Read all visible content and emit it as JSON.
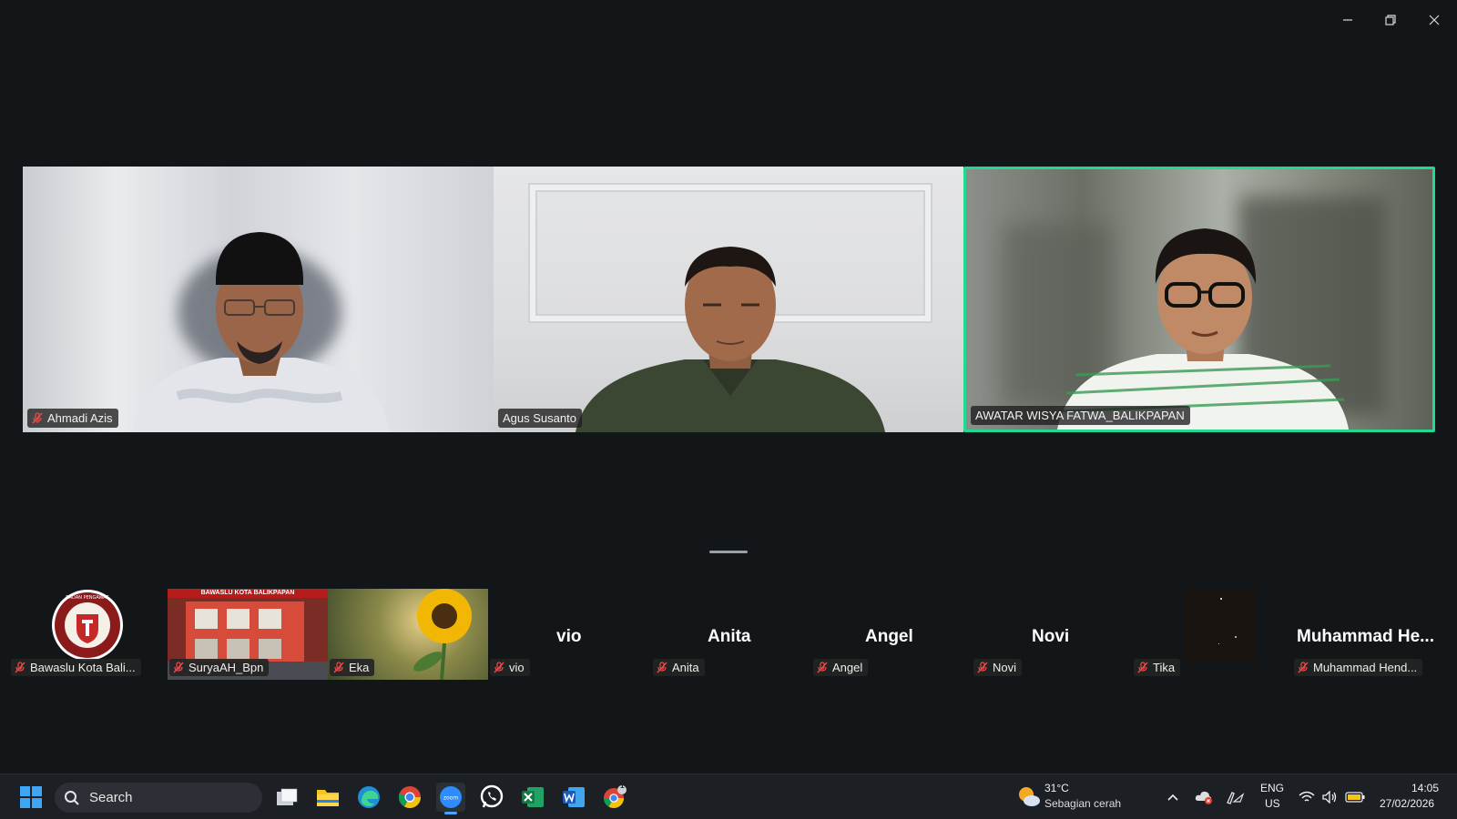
{
  "window": {
    "minimize_icon": "minimize-icon",
    "restore_icon": "restore-icon",
    "close_icon": "close-icon"
  },
  "gallery": {
    "participants": [
      {
        "name": "Ahmadi Azis",
        "muted": true
      },
      {
        "name": "Agus Susanto",
        "muted": false
      },
      {
        "name": "AWATAR WISYA FATWA_BALIKPAPAN",
        "muted": false,
        "active_speaker": true
      }
    ],
    "active_border_color": "#23d990"
  },
  "strip": {
    "participants": [
      {
        "tag": "Bawaslu Kota Bali...",
        "display": "",
        "type": "logo"
      },
      {
        "tag": "SuryaAH_Bpn",
        "display": "",
        "type": "video"
      },
      {
        "tag": "Eka",
        "display": "",
        "type": "video"
      },
      {
        "tag": "vio",
        "display": "vio",
        "type": "name"
      },
      {
        "tag": "Anita",
        "display": "Anita",
        "type": "name"
      },
      {
        "tag": "Angel",
        "display": "Angel",
        "type": "name"
      },
      {
        "tag": "Novi",
        "display": "Novi",
        "type": "name"
      },
      {
        "tag": "Tika",
        "display": "",
        "type": "video"
      },
      {
        "tag": "Muhammad Hend...",
        "display": "Muhammad He...",
        "type": "name"
      }
    ],
    "logo_text": "BADAN PENGAWAS PEMILIHAN UMUM",
    "building_sign": "BAWASLU KOTA BALIKPAPAN"
  },
  "taskbar": {
    "search_label": "Search",
    "apps": [
      "start-icon",
      "task-view-icon",
      "file-explorer-icon",
      "edge-icon",
      "chrome-icon",
      "zoom-icon",
      "whatsapp-icon",
      "excel-icon",
      "word-icon",
      "chrome-profile-icon"
    ],
    "weather_temp": "31°C",
    "weather_desc": "Sebagian cerah",
    "lang_top": "ENG",
    "lang_bottom": "US",
    "time": "14:05",
    "date": "27/02/2026",
    "chrome_badge": "1"
  }
}
